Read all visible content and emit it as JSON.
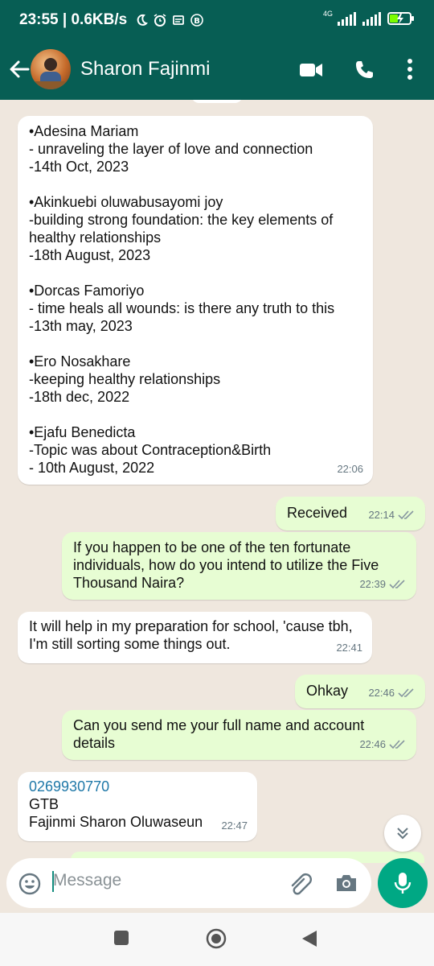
{
  "status": {
    "time_speed": "23:55 | 0.6KB/s",
    "network": "4G",
    "icons": [
      "moon-icon",
      "alarm-icon",
      "message-icon",
      "b-badge-icon",
      "signal-icon",
      "battery-icon"
    ]
  },
  "header": {
    "contact_name": "Sharon Fajinmi",
    "back_icon": "arrow-left-icon",
    "video_icon": "video-camera-icon",
    "call_icon": "phone-icon",
    "menu_icon": "more-vert-icon"
  },
  "messages": [
    {
      "direction": "incoming",
      "text": "•Adesina Mariam\n- unraveling the layer of love and connection\n-14th Oct, 2023\n\n•Akinkuebi oluwabusayomi joy\n-building strong foundation: the key elements of healthy relationships\n-18th August, 2023\n\n•Dorcas Famoriyo\n- time heals all wounds: is there any truth to this\n-13th may, 2023\n\n•Ero Nosakhare\n-keeping healthy relationships\n-18th dec, 2022\n\n•Ejafu Benedicta\n-Topic was about Contraception&Birth\n- 10th August, 2022",
      "time": "22:06"
    },
    {
      "direction": "outgoing",
      "text": "Received",
      "time": "22:14",
      "status": "read"
    },
    {
      "direction": "outgoing",
      "text": "If you happen to be one of the ten fortunate individuals, how do you intend to utilize the Five Thousand Naira?",
      "time": "22:39",
      "status": "read"
    },
    {
      "direction": "incoming",
      "text": "It will help in my preparation for school, 'cause tbh, I'm still sorting some things out.",
      "time": "22:41"
    },
    {
      "direction": "outgoing",
      "text": "Ohkay",
      "time": "22:46",
      "status": "read"
    },
    {
      "direction": "outgoing",
      "text": "Can you send me your full name and account details",
      "time": "22:46",
      "status": "read"
    },
    {
      "direction": "incoming",
      "account_number": "0269930770",
      "bank": "GTB",
      "full_name": "Fajinmi Sharon Oluwaseun",
      "time": "22:47"
    }
  ],
  "composer": {
    "placeholder": "Message",
    "emoji_icon": "emoji-icon",
    "attach_icon": "paperclip-icon",
    "camera_icon": "camera-icon",
    "mic_icon": "microphone-icon"
  },
  "colors": {
    "header": "#075e54",
    "outgoing_bubble": "#e7fdd3",
    "incoming_bubble": "#ffffff",
    "chat_background": "#efe7de",
    "mic_button": "#00a884",
    "link": "#1f78a8",
    "read_ticks": "#8696a0"
  }
}
